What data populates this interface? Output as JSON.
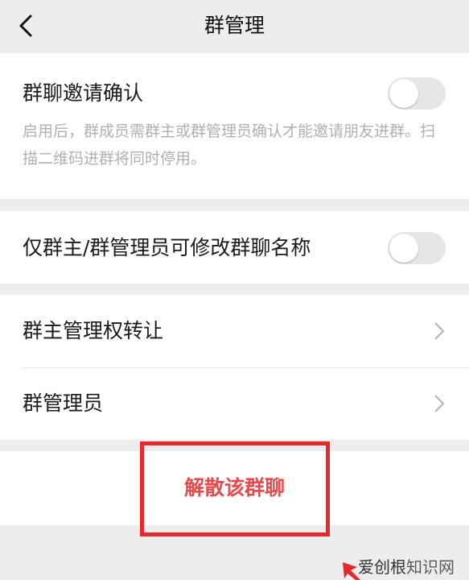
{
  "header": {
    "title": "群管理"
  },
  "invite_confirm": {
    "label": "群聊邀请确认",
    "description": "启用后，群成员需群主或群管理员确认才能邀请朋友进群。扫描二维码进群将同时停用。",
    "enabled": false
  },
  "rename_restrict": {
    "label": "仅群主/群管理员可修改群聊名称",
    "enabled": false
  },
  "admin_items": [
    {
      "label": "群主管理权转让"
    },
    {
      "label": "群管理员"
    }
  ],
  "dissolve": {
    "label": "解散该群聊"
  },
  "watermark": {
    "part1": "爱创根",
    "part2": "知识网"
  },
  "colors": {
    "danger": "#e8494c",
    "highlight": "#e8282c",
    "background": "#ededed"
  }
}
